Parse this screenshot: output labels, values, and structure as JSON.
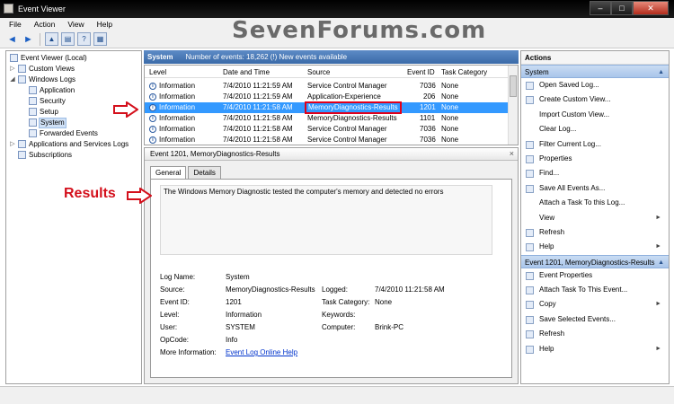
{
  "window": {
    "title": "Event Viewer",
    "minimize": "–",
    "maximize": "□",
    "close": "✕"
  },
  "watermark": "SevenForums.com",
  "menu": [
    "File",
    "Action",
    "View",
    "Help"
  ],
  "toolbar": {
    "back": "◄",
    "forward": "►",
    "up": "▲",
    "console": "▤",
    "help": "?",
    "properties": "▦"
  },
  "tree": {
    "root": "Event Viewer (Local)",
    "custom_views": "Custom Views",
    "windows_logs": "Windows Logs",
    "application": "Application",
    "security": "Security",
    "setup": "Setup",
    "system": "System",
    "forwarded": "Forwarded Events",
    "apps_services": "Applications and Services Logs",
    "subscriptions": "Subscriptions"
  },
  "log_header": {
    "name": "System",
    "count": "Number of events: 18,262 (!) New events available"
  },
  "columns": [
    "Level",
    "Date and Time",
    "Source",
    "Event ID",
    "Task Category"
  ],
  "rows": [
    {
      "level": "Information",
      "date": "7/4/2010 11:21:59 AM",
      "source": "Service Control Manager",
      "id": "7036",
      "task": "None"
    },
    {
      "level": "Information",
      "date": "7/4/2010 11:21:59 AM",
      "source": "Application-Experience",
      "id": "206",
      "task": "None"
    },
    {
      "level": "Information",
      "date": "7/4/2010 11:21:58 AM",
      "source": "MemoryDiagnostics-Results",
      "id": "1201",
      "task": "None"
    },
    {
      "level": "Information",
      "date": "7/4/2010 11:21:58 AM",
      "source": "MemoryDiagnostics-Results",
      "id": "1101",
      "task": "None"
    },
    {
      "level": "Information",
      "date": "7/4/2010 11:21:58 AM",
      "source": "Service Control Manager",
      "id": "7036",
      "task": "None"
    },
    {
      "level": "Information",
      "date": "7/4/2010 11:21:58 AM",
      "source": "Service Control Manager",
      "id": "7036",
      "task": "None"
    }
  ],
  "detail": {
    "title": "Event 1201, MemoryDiagnostics-Results",
    "close": "×",
    "tab_general": "General",
    "tab_details": "Details",
    "description": "The Windows Memory Diagnostic tested the computer's memory and detected no errors",
    "log_name_label": "Log Name:",
    "log_name": "System",
    "source_label": "Source:",
    "source": "MemoryDiagnostics-Results",
    "logged_label": "Logged:",
    "logged": "7/4/2010 11:21:58 AM",
    "event_id_label": "Event ID:",
    "event_id": "1201",
    "task_label": "Task Category:",
    "task": "None",
    "level_label": "Level:",
    "level": "Information",
    "keywords_label": "Keywords:",
    "keywords": "",
    "user_label": "User:",
    "user": "SYSTEM",
    "computer_label": "Computer:",
    "computer": "Brink-PC",
    "opcode_label": "OpCode:",
    "opcode": "Info",
    "more_info_label": "More Information:",
    "more_info_link": "Event Log Online Help"
  },
  "actions": {
    "title": "Actions",
    "section1": "System",
    "section1_items": [
      "Open Saved Log...",
      "Create Custom View...",
      "Import Custom View...",
      "Clear Log...",
      "Filter Current Log...",
      "Properties",
      "Find...",
      "Save All Events As...",
      "Attach a Task To this Log...",
      "View",
      "Refresh",
      "Help"
    ],
    "section2": "Event 1201, MemoryDiagnostics-Results",
    "section2_items": [
      "Event Properties",
      "Attach Task To This Event...",
      "Copy",
      "Save Selected Events...",
      "Refresh",
      "Help"
    ],
    "submenu_arrow": "►",
    "collapse_arrow": "▲"
  },
  "annotation": {
    "results_label": "Results",
    "accent_color": "#d4101c"
  }
}
